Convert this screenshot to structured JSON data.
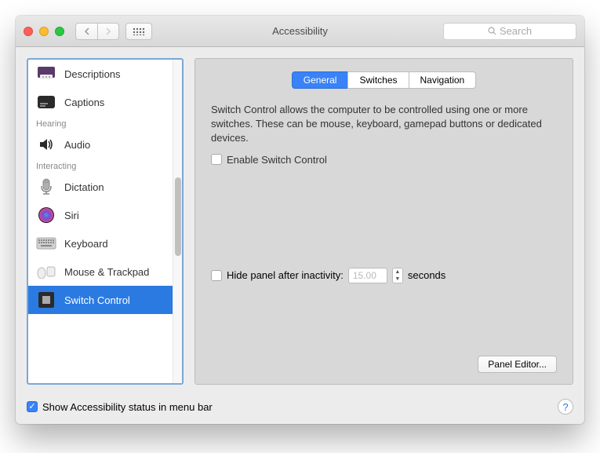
{
  "window": {
    "title": "Accessibility"
  },
  "search": {
    "placeholder": "Search"
  },
  "sidebar": {
    "sections": {
      "hearing": "Hearing",
      "interacting": "Interacting"
    },
    "items": {
      "descriptions": "Descriptions",
      "captions": "Captions",
      "audio": "Audio",
      "dictation": "Dictation",
      "siri": "Siri",
      "keyboard": "Keyboard",
      "mouse_trackpad": "Mouse & Trackpad",
      "switch_control": "Switch Control"
    }
  },
  "tabs": {
    "general": "General",
    "switches": "Switches",
    "navigation": "Navigation"
  },
  "main": {
    "description": "Switch Control allows the computer to be controlled using one or more switches. These can be mouse, keyboard, gamepad buttons or dedicated devices.",
    "enable_label": "Enable Switch Control",
    "hide_label": "Hide panel after inactivity:",
    "inactivity_value": "15.00",
    "seconds": "seconds",
    "panel_editor": "Panel Editor..."
  },
  "footer": {
    "show_status": "Show Accessibility status in menu bar"
  }
}
